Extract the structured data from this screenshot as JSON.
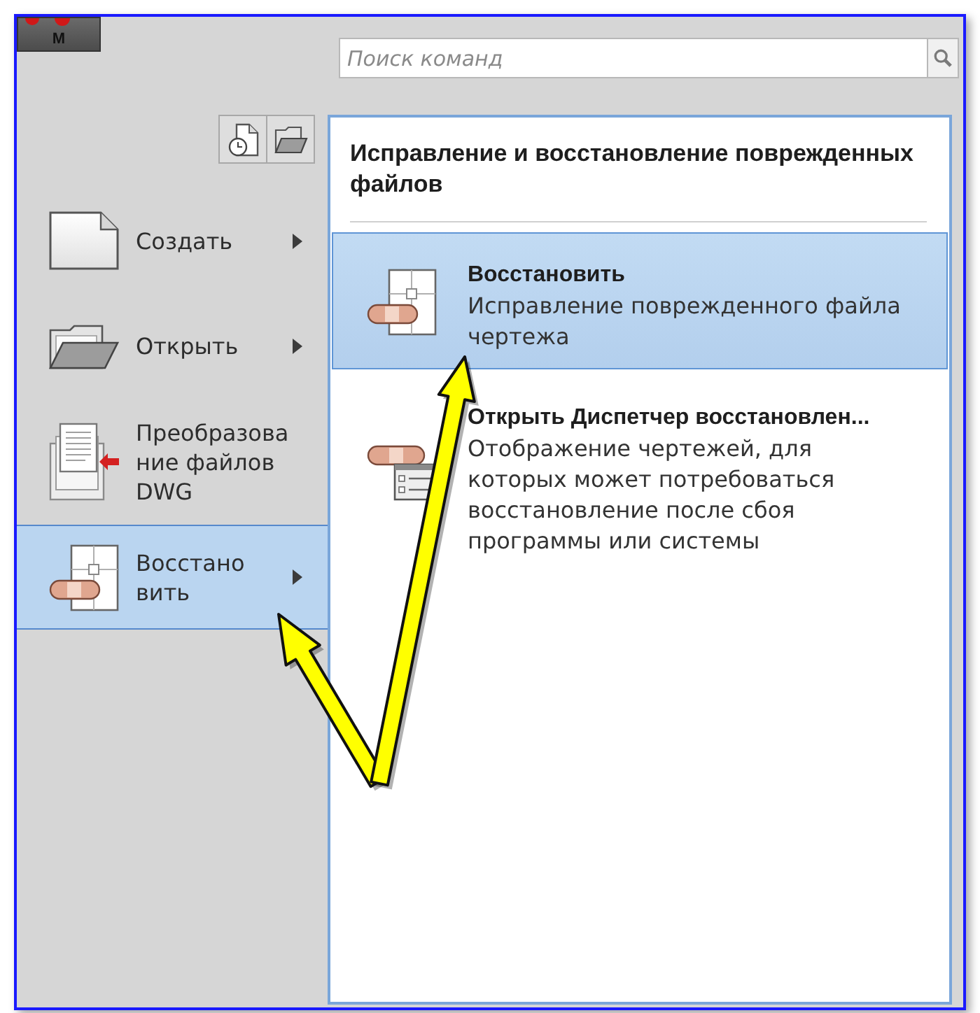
{
  "app_button": {
    "label": "M"
  },
  "search": {
    "placeholder": "Поиск команд"
  },
  "toolbar": [
    {
      "kind": "recent"
    },
    {
      "kind": "open"
    }
  ],
  "menu": {
    "items": [
      {
        "kind": "new",
        "lines": [
          "Создать"
        ],
        "has_submenu": true,
        "selected": false
      },
      {
        "kind": "open",
        "lines": [
          "Открыть"
        ],
        "has_submenu": true,
        "selected": false
      },
      {
        "kind": "convert",
        "lines": [
          "Преобразова",
          "ние файлов",
          "DWG"
        ],
        "has_submenu": false,
        "selected": false
      },
      {
        "kind": "recover",
        "lines": [
          "Восстано",
          "вить"
        ],
        "has_submenu": true,
        "selected": true
      }
    ]
  },
  "submenu": {
    "heading": [
      "Исправление и восстановление поврежденных",
      "файлов"
    ],
    "items": [
      {
        "kind": "recover",
        "title": "Восстановить",
        "description": [
          "Исправление поврежденного файла",
          "чертежа"
        ],
        "selected": true
      },
      {
        "kind": "recovery_manager",
        "title": "Открыть Диспетчер восстановлен...",
        "description": [
          "Отображение чертежей, для",
          "которых может потребоваться",
          "восстановление после сбоя",
          "программы или системы"
        ],
        "selected": false
      }
    ]
  }
}
